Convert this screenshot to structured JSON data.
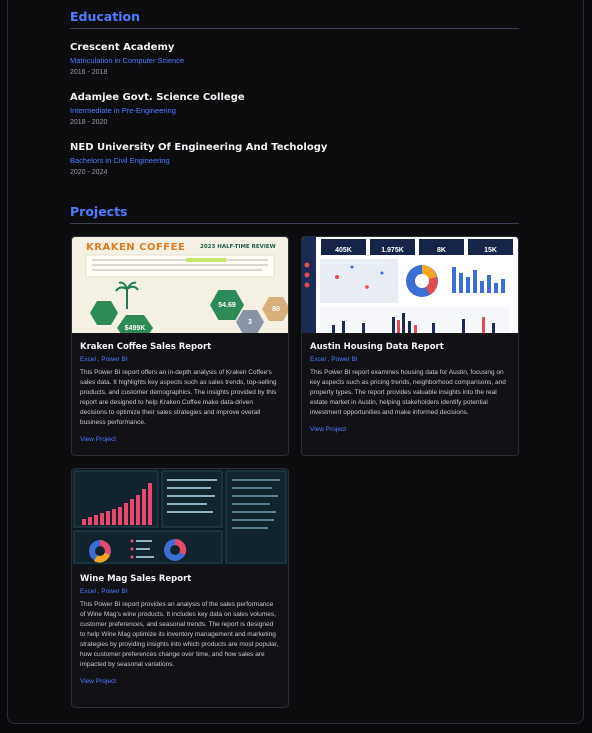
{
  "education": {
    "title": "Education",
    "items": [
      {
        "school": "Crescent Academy",
        "degree": "Matriculation in Computer Science",
        "years": "2016 - 2018"
      },
      {
        "school": "Adamjee Govt. Science College",
        "degree": "Intermediate in Pre-Engineering",
        "years": "2018 - 2020"
      },
      {
        "school": "NED University Of Engineering And Techology",
        "degree": "Bachelors in Civil Engineering",
        "years": "2020 - 2024"
      }
    ]
  },
  "projects": {
    "title": "Projects",
    "link_label": "View Project",
    "items": [
      {
        "title": "Kraken Coffee Sales Report",
        "tags": "Excel , Power BI",
        "description": "This Power BI report offers an in-depth analysis of Kraken Coffee's sales data. It highlights key aspects such as sales trends, top-selling products, and customer demographics. The insights provided by this report are designed to help Kraken Coffee make data-driven decisions to optimize their sales strategies and improve overall business performance.",
        "thumb": {
          "logo": "KRAKEN COFFEE",
          "heading": "2023 HALF-TIME REVIEW",
          "kpis": [
            "$499K",
            "54.69",
            "3",
            "80"
          ]
        }
      },
      {
        "title": "Austin Housing Data Report",
        "tags": "Excel , Power BI",
        "description": "This Power BI report examines housing data for Austin, focusing on key aspects such as pricing trends, neighborhood comparisons, and property types. The report provides valuable insights into the real estate market in Austin, helping stakeholders identify potential investment opportunities and make informed decisions.",
        "thumb": {
          "kpis": [
            "405K",
            "1.975K",
            "8K",
            "15K"
          ]
        }
      },
      {
        "title": "Wine Mag Sales Report",
        "tags": "Excel , Power BI",
        "description": "This Power BI report provides an analysis of the sales performance of Wine Mag's wine products. It includes key data on sales volumes, customer preferences, and seasonal trends. The report is designed to help Wine Mag optimize its inventory management and marketing strategies by providing insights into which products are most popular, how customer preferences change over time, and how sales are impacted by seasonal variations."
      }
    ]
  },
  "colors": {
    "accent": "#4f7cff",
    "background": "#0d0d10",
    "card": "#111116"
  }
}
